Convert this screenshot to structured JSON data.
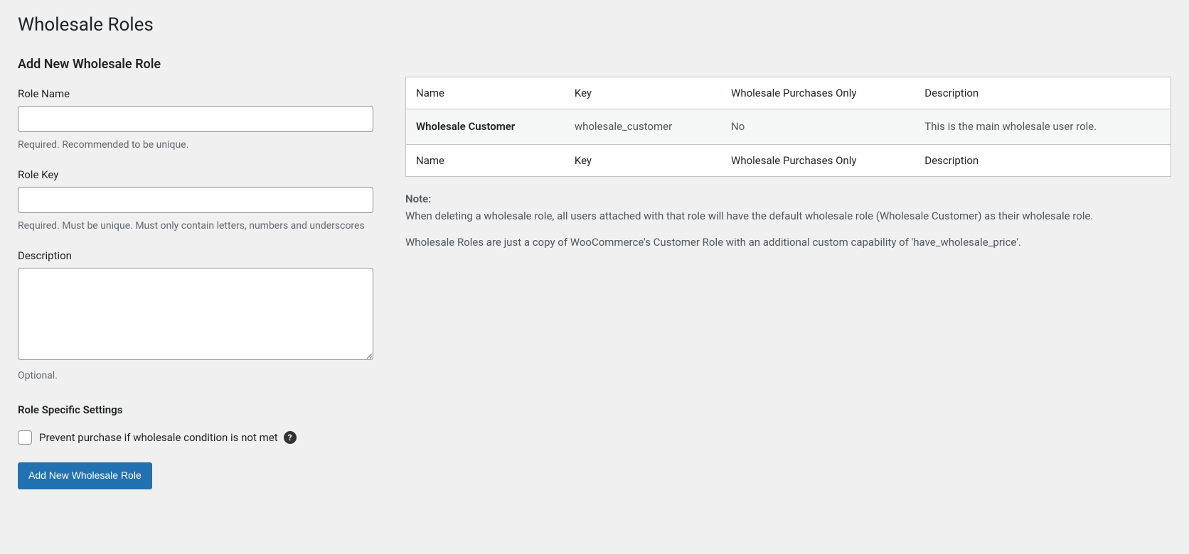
{
  "page": {
    "title": "Wholesale Roles"
  },
  "form": {
    "heading": "Add New Wholesale Role",
    "role_name": {
      "label": "Role Name",
      "value": "",
      "helper": "Required. Recommended to be unique."
    },
    "role_key": {
      "label": "Role Key",
      "value": "",
      "helper": "Required. Must be unique. Must only contain letters, numbers and underscores"
    },
    "description": {
      "label": "Description",
      "value": "",
      "helper": "Optional."
    },
    "settings_heading": "Role Specific Settings",
    "prevent_purchase": {
      "label": "Prevent purchase if wholesale condition is not met",
      "checked": false
    },
    "submit_label": "Add New Wholesale Role"
  },
  "table": {
    "columns": [
      "Name",
      "Key",
      "Wholesale Purchases Only",
      "Description"
    ],
    "rows": [
      {
        "name": "Wholesale Customer",
        "key": "wholesale_customer",
        "wholesale_only": "No",
        "description": "This is the main wholesale user role."
      }
    ]
  },
  "note": {
    "heading": "Note:",
    "p1": "When deleting a wholesale role, all users attached with that role will have the default wholesale role (Wholesale Customer) as their wholesale role.",
    "p2": "Wholesale Roles are just a copy of WooCommerce's Customer Role with an additional custom capability of 'have_wholesale_price'."
  }
}
